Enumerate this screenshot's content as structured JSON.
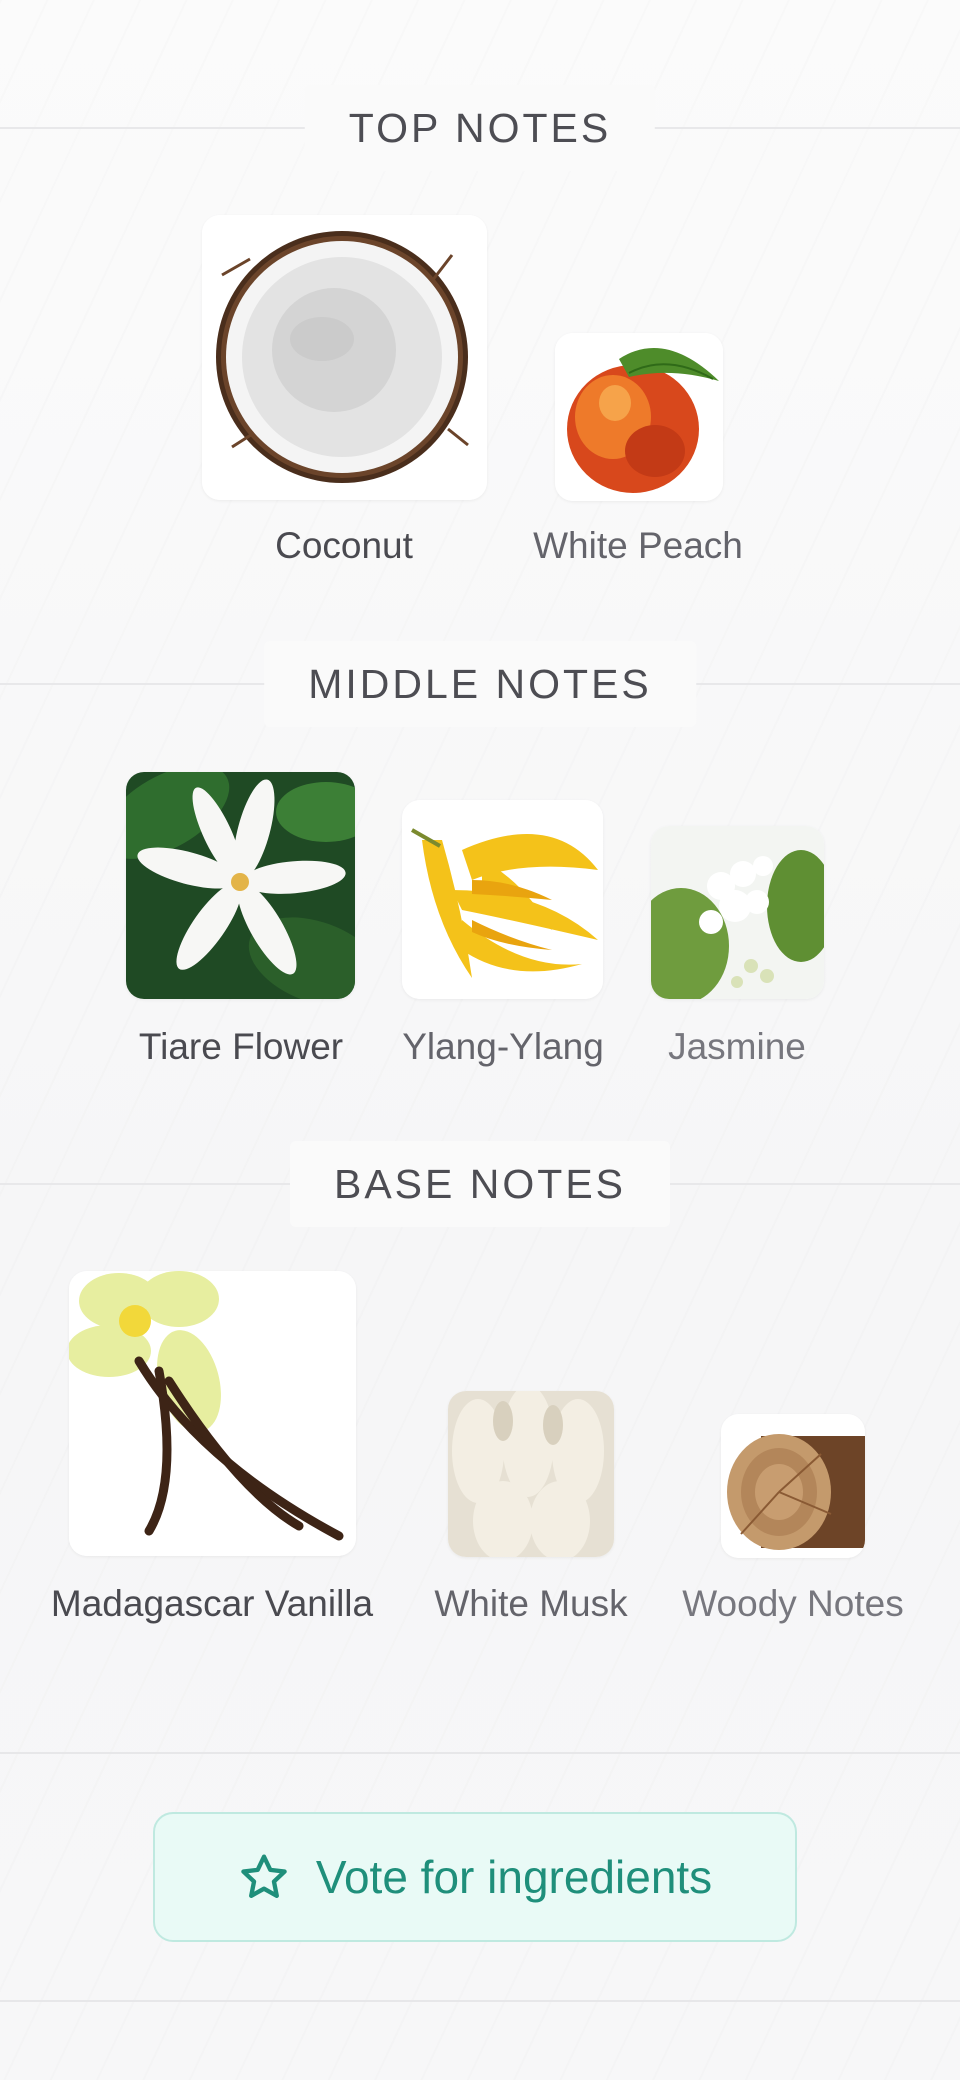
{
  "sections": {
    "top": {
      "title": "TOP NOTES",
      "notes": [
        "Coconut",
        "White Peach"
      ]
    },
    "middle": {
      "title": "MIDDLE NOTES",
      "notes": [
        "Tiare Flower",
        "Ylang-Ylang",
        "Jasmine"
      ]
    },
    "base": {
      "title": "BASE NOTES",
      "notes": [
        "Madagascar Vanilla",
        "White Musk",
        "Woody Notes"
      ]
    }
  },
  "vote": {
    "label": "Vote for ingredients",
    "icon": "star-icon"
  },
  "colors": {
    "accent": "#1f8f7b",
    "accent_bg": "#e9faf6",
    "accent_border": "#bfe9e0"
  }
}
